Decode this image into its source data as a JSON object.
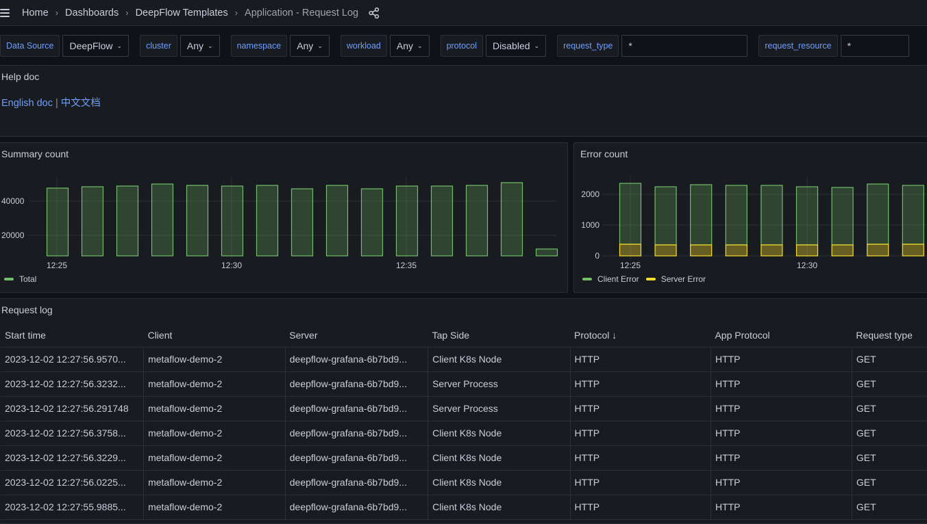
{
  "header": {
    "breadcrumbs": [
      "Home",
      "Dashboards",
      "DeepFlow Templates",
      "Application - Request Log"
    ]
  },
  "variables": [
    {
      "label": "Data Source",
      "value": "DeepFlow",
      "type": "select"
    },
    {
      "label": "cluster",
      "value": "Any",
      "type": "select"
    },
    {
      "label": "namespace",
      "value": "Any",
      "type": "select"
    },
    {
      "label": "workload",
      "value": "Any",
      "type": "select"
    },
    {
      "label": "protocol",
      "value": "Disabled",
      "type": "select"
    },
    {
      "label": "request_type",
      "value": "*",
      "type": "text"
    },
    {
      "label": "request_resource",
      "value": "*",
      "type": "text"
    }
  ],
  "help_panel": {
    "title": "Help doc",
    "link_en": "English doc",
    "separator": "|",
    "link_zh": "中文文档"
  },
  "colors": {
    "green": "#73bf69",
    "yellow": "#fade2a",
    "link": "#6e9fff"
  },
  "chart_data": [
    {
      "type": "bar",
      "title": "Summary count",
      "x": [
        "12:25",
        "12:26",
        "12:27",
        "12:28",
        "12:29",
        "12:30",
        "12:31",
        "12:32",
        "12:33",
        "12:34",
        "12:35",
        "12:36",
        "12:37",
        "12:38",
        "12:39"
      ],
      "xticks": [
        "12:25",
        "12:30",
        "12:35"
      ],
      "yticks": [
        20000,
        40000
      ],
      "ylim": [
        8000,
        55000
      ],
      "series": [
        {
          "name": "Total",
          "color": "#73bf69",
          "values": [
            47600,
            48400,
            48800,
            50000,
            49200,
            48800,
            49200,
            47200,
            49200,
            47200,
            48800,
            48800,
            49200,
            50800,
            12000
          ]
        }
      ],
      "legend": "bottom-left",
      "grid": true
    },
    {
      "type": "bar",
      "stacked": true,
      "title": "Error count",
      "x": [
        "12:25",
        "12:26",
        "12:27",
        "12:28",
        "12:29",
        "12:30",
        "12:31",
        "12:32",
        "12:33"
      ],
      "xticks": [
        "12:25",
        "12:30"
      ],
      "yticks": [
        0,
        1000,
        2000
      ],
      "ylim": [
        0,
        2700
      ],
      "series": [
        {
          "name": "Server Error",
          "color": "#fade2a",
          "values": [
            378,
            356,
            356,
            356,
            356,
            356,
            356,
            378,
            378
          ]
        },
        {
          "name": "Client Error",
          "color": "#73bf69",
          "values": [
            1978,
            1888,
            1955,
            1933,
            1933,
            1888,
            1866,
            1955,
            1911
          ]
        }
      ],
      "legend_order": [
        "Client Error",
        "Server Error"
      ],
      "legend": "bottom-left",
      "grid": true
    }
  ],
  "request_log": {
    "title": "Request log",
    "columns": [
      "Start time",
      "Client",
      "Server",
      "Tap Side",
      "Protocol",
      "App Protocol",
      "Request type"
    ],
    "sort_column": "Protocol",
    "sort_indicator": "↓",
    "rows": [
      [
        "2023-12-02 12:27:56.9570...",
        "metaflow-demo-2",
        "deepflow-grafana-6b7bd9...",
        "Client K8s Node",
        "HTTP",
        "HTTP",
        "GET"
      ],
      [
        "2023-12-02 12:27:56.3232...",
        "metaflow-demo-2",
        "deepflow-grafana-6b7bd9...",
        "Server Process",
        "HTTP",
        "HTTP",
        "GET"
      ],
      [
        "2023-12-02 12:27:56.291748",
        "metaflow-demo-2",
        "deepflow-grafana-6b7bd9...",
        "Server Process",
        "HTTP",
        "HTTP",
        "GET"
      ],
      [
        "2023-12-02 12:27:56.3758...",
        "metaflow-demo-2",
        "deepflow-grafana-6b7bd9...",
        "Client K8s Node",
        "HTTP",
        "HTTP",
        "GET"
      ],
      [
        "2023-12-02 12:27:56.3229...",
        "metaflow-demo-2",
        "deepflow-grafana-6b7bd9...",
        "Client K8s Node",
        "HTTP",
        "HTTP",
        "GET"
      ],
      [
        "2023-12-02 12:27:56.0225...",
        "metaflow-demo-2",
        "deepflow-grafana-6b7bd9...",
        "Client K8s Node",
        "HTTP",
        "HTTP",
        "GET"
      ],
      [
        "2023-12-02 12:27:55.9885...",
        "metaflow-demo-2",
        "deepflow-grafana-6b7bd9...",
        "Client K8s Node",
        "HTTP",
        "HTTP",
        "GET"
      ]
    ]
  }
}
